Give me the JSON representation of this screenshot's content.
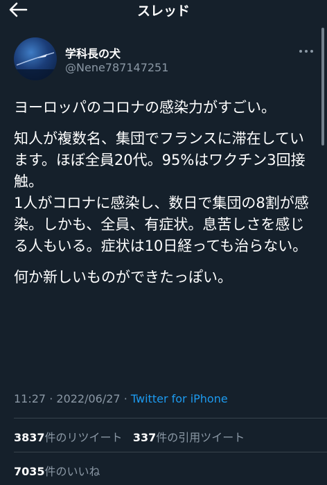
{
  "header": {
    "title": "スレッド",
    "back_icon": "back-arrow-icon"
  },
  "tweet": {
    "author_name": "学科長の犬",
    "author_handle": "@Nene787147251",
    "paragraphs": [
      "ヨーロッパのコロナの感染力がすごい。",
      "知人が複数名、集団でフランスに滞在しています。ほぼ全員20代。95%はワクチン3回接触。",
      "1人がコロナに感染し、数日で集団の8割が感染。しかも、全員、有症状。息苦しさを感じる人もいる。症状は10日経っても治らない。",
      "何か新しいものができたっぽい。"
    ],
    "time": "11:27",
    "date": "2022/06/27",
    "separator": "·",
    "source": "Twitter for iPhone",
    "retweets": "3837",
    "retweets_label": "件のリツイート",
    "quotes": "337",
    "quotes_label": "件の引用ツイート",
    "likes": "7035",
    "likes_label": "件のいいね"
  },
  "colors": {
    "background": "#15202b",
    "accent": "#1d9bf0",
    "muted": "#8b98a5",
    "divider": "#38444d"
  }
}
